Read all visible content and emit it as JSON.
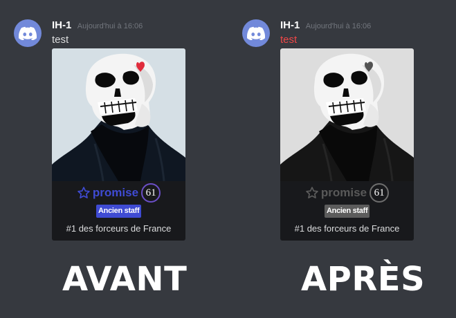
{
  "colors": {
    "background": "#36393f",
    "discord_blurple": "#7289da",
    "message_red": "#f04747",
    "avant_accent": "#3f4bd3",
    "apres_accent": "#5c5c5c"
  },
  "messages": [
    {
      "username": "IH-1",
      "timestamp": "Aujourd'hui à 16:06",
      "content": "test",
      "avatar_icon": "discord-logo-icon",
      "card": {
        "name": "promise",
        "level": "61",
        "badge": "Ancien staff",
        "description": "#1 des forceurs de France",
        "star_icon": "star-outline-icon",
        "filter": "color"
      }
    },
    {
      "username": "IH-1",
      "timestamp": "Aujourd'hui à 16:06",
      "content": "test",
      "avatar_icon": "discord-logo-icon",
      "card": {
        "name": "promise",
        "level": "61",
        "badge": "Ancien staff",
        "description": "#1 des forceurs de France",
        "star_icon": "star-outline-icon",
        "filter": "grayscale"
      }
    }
  ],
  "captions": {
    "before": "AVANT",
    "after": "APRÈS"
  }
}
